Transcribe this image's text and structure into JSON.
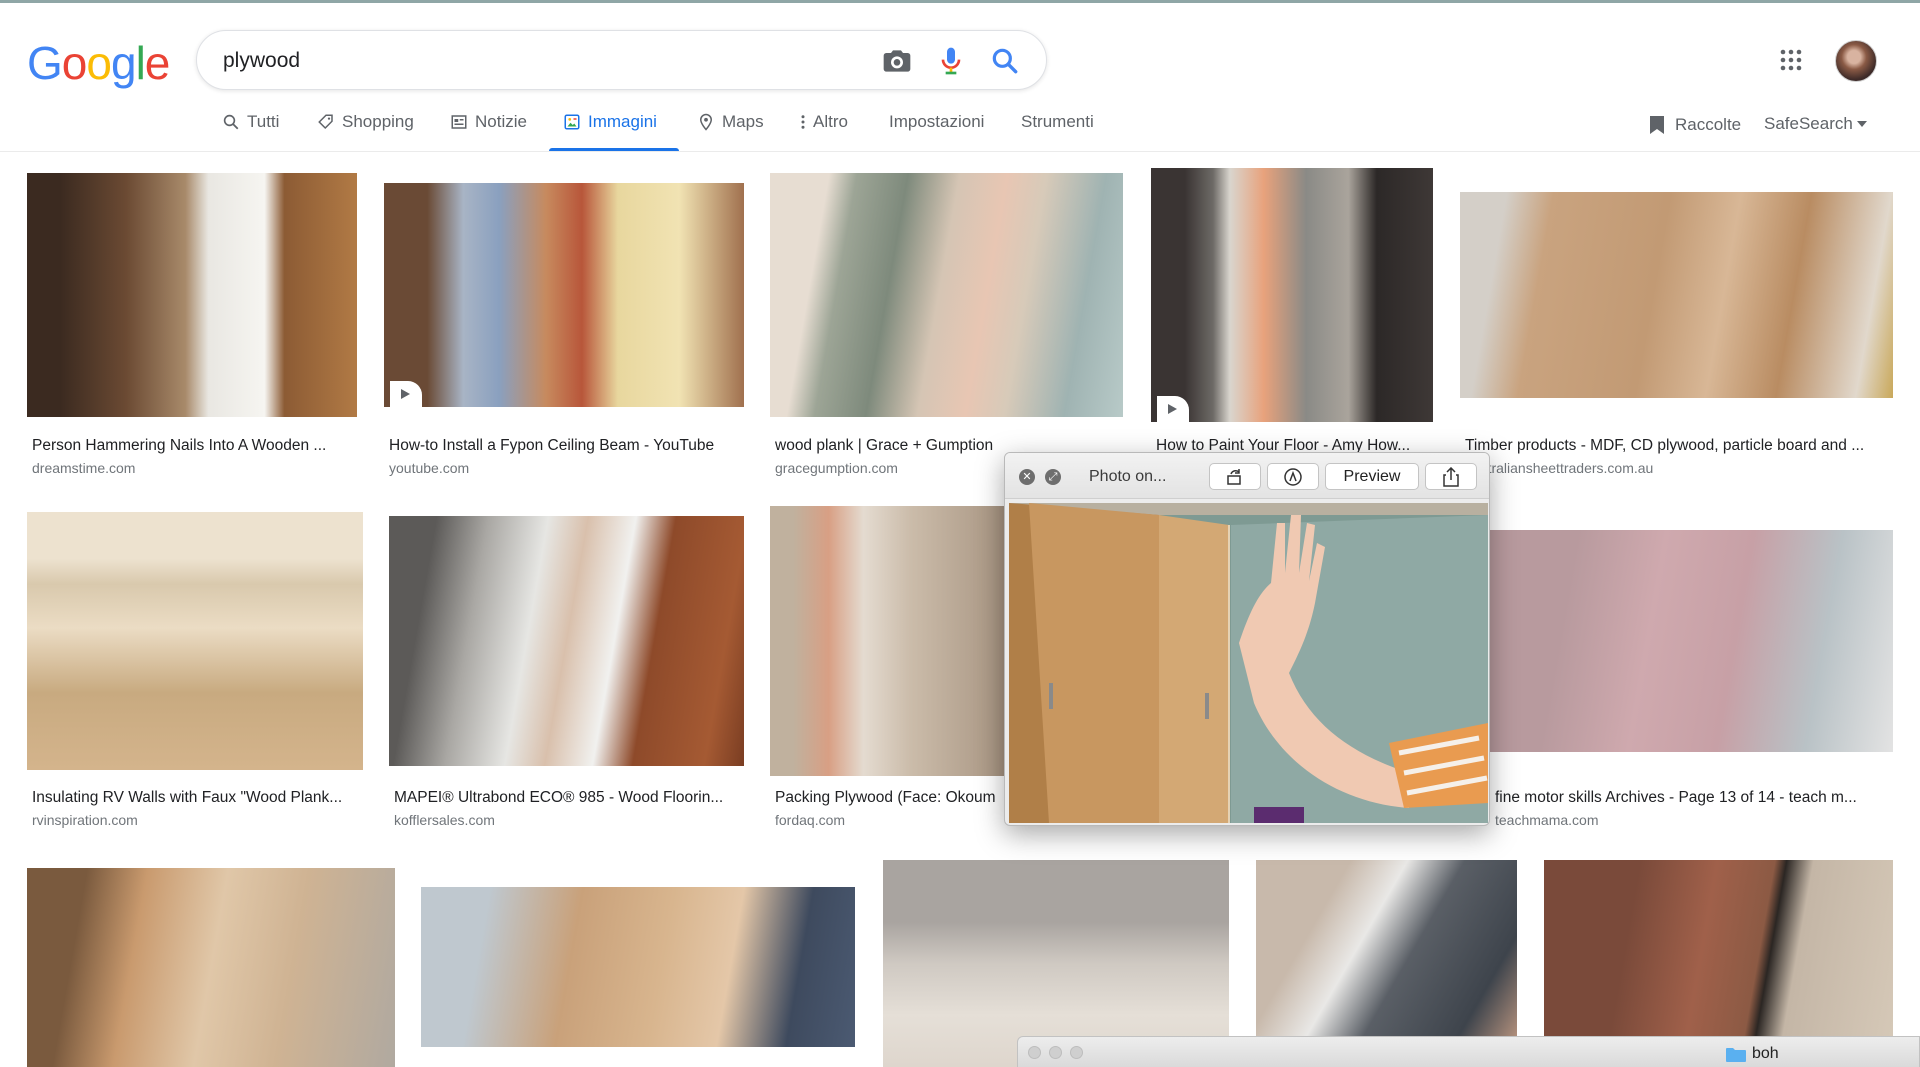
{
  "search": {
    "logo": "Google",
    "query": "plywood"
  },
  "tabs": [
    {
      "label": "Tutti",
      "icon": "search-icon"
    },
    {
      "label": "Shopping",
      "icon": "tag-icon"
    },
    {
      "label": "Notizie",
      "icon": "news-icon"
    },
    {
      "label": "Immagini",
      "icon": "image-icon",
      "active": true
    },
    {
      "label": "Maps",
      "icon": "map-pin-icon"
    },
    {
      "label": "Altro",
      "icon": "more-vert-icon"
    },
    {
      "label": "Impostazioni"
    },
    {
      "label": "Strumenti"
    }
  ],
  "header_right": {
    "collections": "Raccolte",
    "safesearch": "SafeSearch"
  },
  "results": [
    {
      "caption": "Person Hammering Nails Into A Wooden ...",
      "source": "dreamstime.com"
    },
    {
      "caption": "How-to Install a Fypon Ceiling Beam - YouTube",
      "source": "youtube.com",
      "video": true
    },
    {
      "caption": "wood plank | Grace + Gumption",
      "source": "gracegumption.com"
    },
    {
      "caption": "How to Paint Your Floor - Amy How...",
      "source": "",
      "video": true
    },
    {
      "caption": "Timber products - MDF, CD plywood, particle board and ...",
      "source": "australiansheettraders.com.au"
    },
    {
      "caption": "Insulating RV Walls with Faux \"Wood Plank...",
      "source": "rvinspiration.com"
    },
    {
      "caption": "MAPEI® Ultrabond ECO® 985 - Wood Floorin...",
      "source": "kofflersales.com"
    },
    {
      "caption": "Packing Plywood (Face: Okoum",
      "source": "fordaq.com"
    },
    {
      "caption": "fine motor skills Archives - Page 13 of 14 - teach m...",
      "source": "teachmama.com"
    }
  ],
  "quicklook": {
    "title": "Photo on...",
    "preview_label": "Preview"
  },
  "finder": {
    "folder": "boh"
  },
  "colors": {
    "accent": "#1a73e8",
    "tab_text": "#5f6368",
    "source_text": "#70757a"
  }
}
